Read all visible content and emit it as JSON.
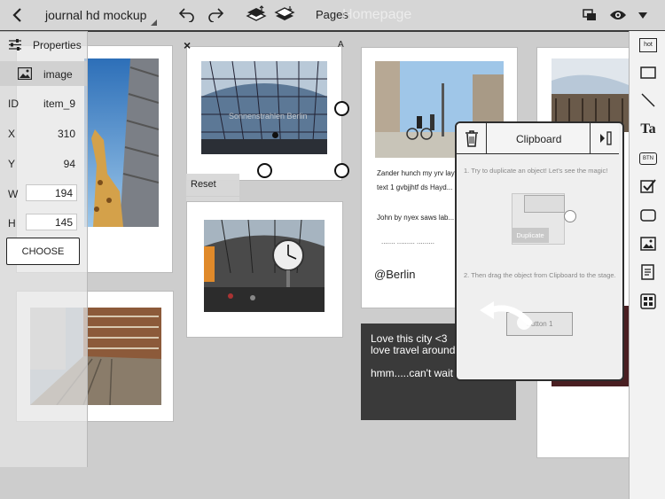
{
  "toolbar": {
    "back_icon": "chevron-left-icon",
    "title": "journal hd mockup",
    "undo_icon": "undo-icon",
    "redo_icon": "redo-icon",
    "bring_forward_icon": "layer-up-icon",
    "send_backward_icon": "layer-down-icon",
    "pages_label": "Pages",
    "ghost_title": "Homepage",
    "fullscreen_icon": "fullscreen-icon",
    "preview_icon": "eye-icon",
    "menu_icon": "caret-down-icon"
  },
  "properties": {
    "header_label": "Properties",
    "type_label": "image",
    "fields": [
      {
        "label": "ID",
        "value": "item_9"
      },
      {
        "label": "X",
        "value": "310"
      },
      {
        "label": "Y",
        "value": "94"
      },
      {
        "label": "W",
        "value": "194"
      },
      {
        "label": "H",
        "value": "145"
      }
    ],
    "choose_label": "CHOOSE"
  },
  "selection": {
    "close_glyph": "×",
    "corner_glyph": "A",
    "caption_overlay": "Sonnenstrahlen Berlin",
    "context_menu": [
      "Reset",
      "Duplicate"
    ]
  },
  "notes_card": {
    "line1": "Zander hunch my yrv layv",
    "line2": "text 1 gvbjjhtf ds Hayd...",
    "line3": "John by nyex saws lab...",
    "dots": "....... ......... .........",
    "tag": "@Berlin"
  },
  "dark_card": {
    "line1": "Love this city <3",
    "line2": "love travel around",
    "line3": "hmm.....can't wait"
  },
  "clipboard": {
    "title": "Clipboard",
    "trash_icon": "trash-icon",
    "collapse_icon": "collapse-right-icon",
    "step1": "1. Try to duplicate an object! Let's see the magic!",
    "demo_duplicate": "Duplicate",
    "step2": "2. Then drag the object from Clipboard to the stage.",
    "demo_button": "Button 1"
  },
  "right_tools": [
    {
      "name": "hotspot-tool",
      "icon": "hot-icon",
      "label": "hot"
    },
    {
      "name": "rectangle-tool",
      "icon": "rectangle-icon",
      "label": ""
    },
    {
      "name": "line-tool",
      "icon": "line-icon",
      "label": ""
    },
    {
      "name": "text-tool",
      "icon": "text-icon",
      "label": "Ta"
    },
    {
      "name": "button-tool",
      "icon": "button-icon",
      "label": "BTN"
    },
    {
      "name": "checkbox-tool",
      "icon": "checkbox-icon",
      "label": ""
    },
    {
      "name": "input-tool",
      "icon": "input-box-icon",
      "label": ""
    },
    {
      "name": "image-tool",
      "icon": "image-icon",
      "label": ""
    },
    {
      "name": "note-tool",
      "icon": "note-icon",
      "label": ""
    },
    {
      "name": "widgets-tool",
      "icon": "grid-icon",
      "label": ""
    }
  ],
  "colors": {
    "stage": "#cdcdcd",
    "dark_card": "#3a3a3a",
    "selection_handle": "#111111"
  }
}
